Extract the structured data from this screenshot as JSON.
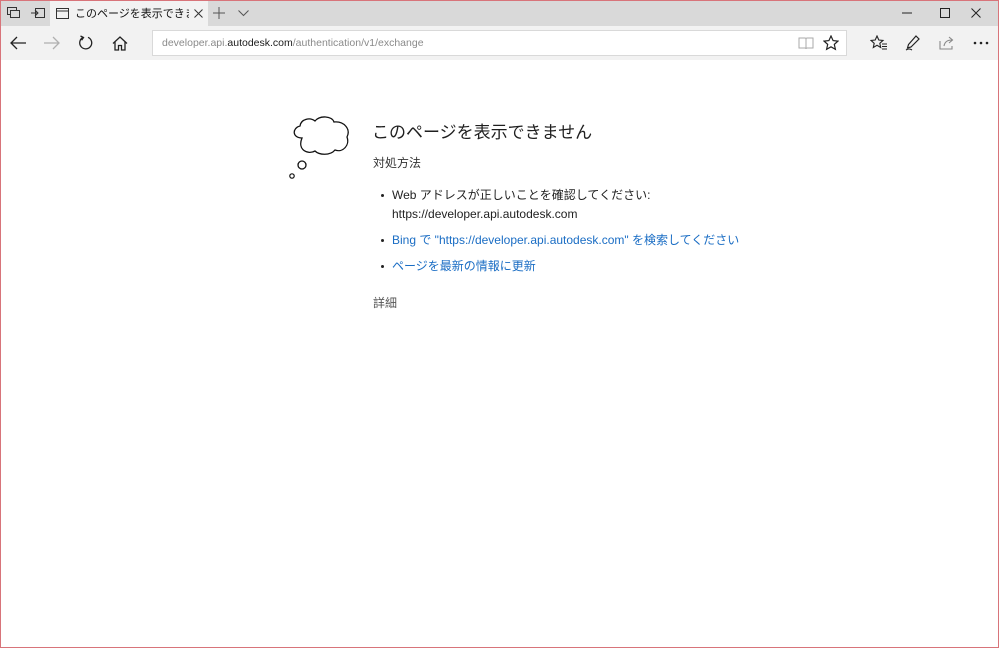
{
  "tab": {
    "title": "このページを表示できません"
  },
  "address_bar": {
    "url_prefix": "developer.api.",
    "url_domain": "autodesk.com",
    "url_path": "/authentication/v1/exchange"
  },
  "toolbar": {
    "icons": [
      "tab-preview-icon",
      "set-aside-tabs-icon",
      "new-tab-icon",
      "tab-list-icon",
      "minimize-icon",
      "maximize-icon",
      "close-window-icon",
      "back-icon",
      "forward-icon",
      "refresh-icon",
      "home-icon",
      "reading-view-icon",
      "favorite-star-icon",
      "favorites-hub-icon",
      "web-note-icon",
      "share-icon",
      "more-icon"
    ]
  },
  "error_page": {
    "title": "このページを表示できません",
    "subtitle": "対処方法",
    "suggestion_1_line_1": "Web アドレスが正しいことを確認してください:",
    "suggestion_1_line_2": "https://developer.api.autodesk.com",
    "suggestion_2": "Bing で \"https://developer.api.autodesk.com\" を検索してください",
    "suggestion_3": "ページを最新の情報に更新",
    "details": "詳細"
  },
  "colors": {
    "titlebar": "#d9d9d9",
    "toolbar": "#f2f2f2",
    "link": "#1a6dc4",
    "frame": "#d8747a"
  }
}
